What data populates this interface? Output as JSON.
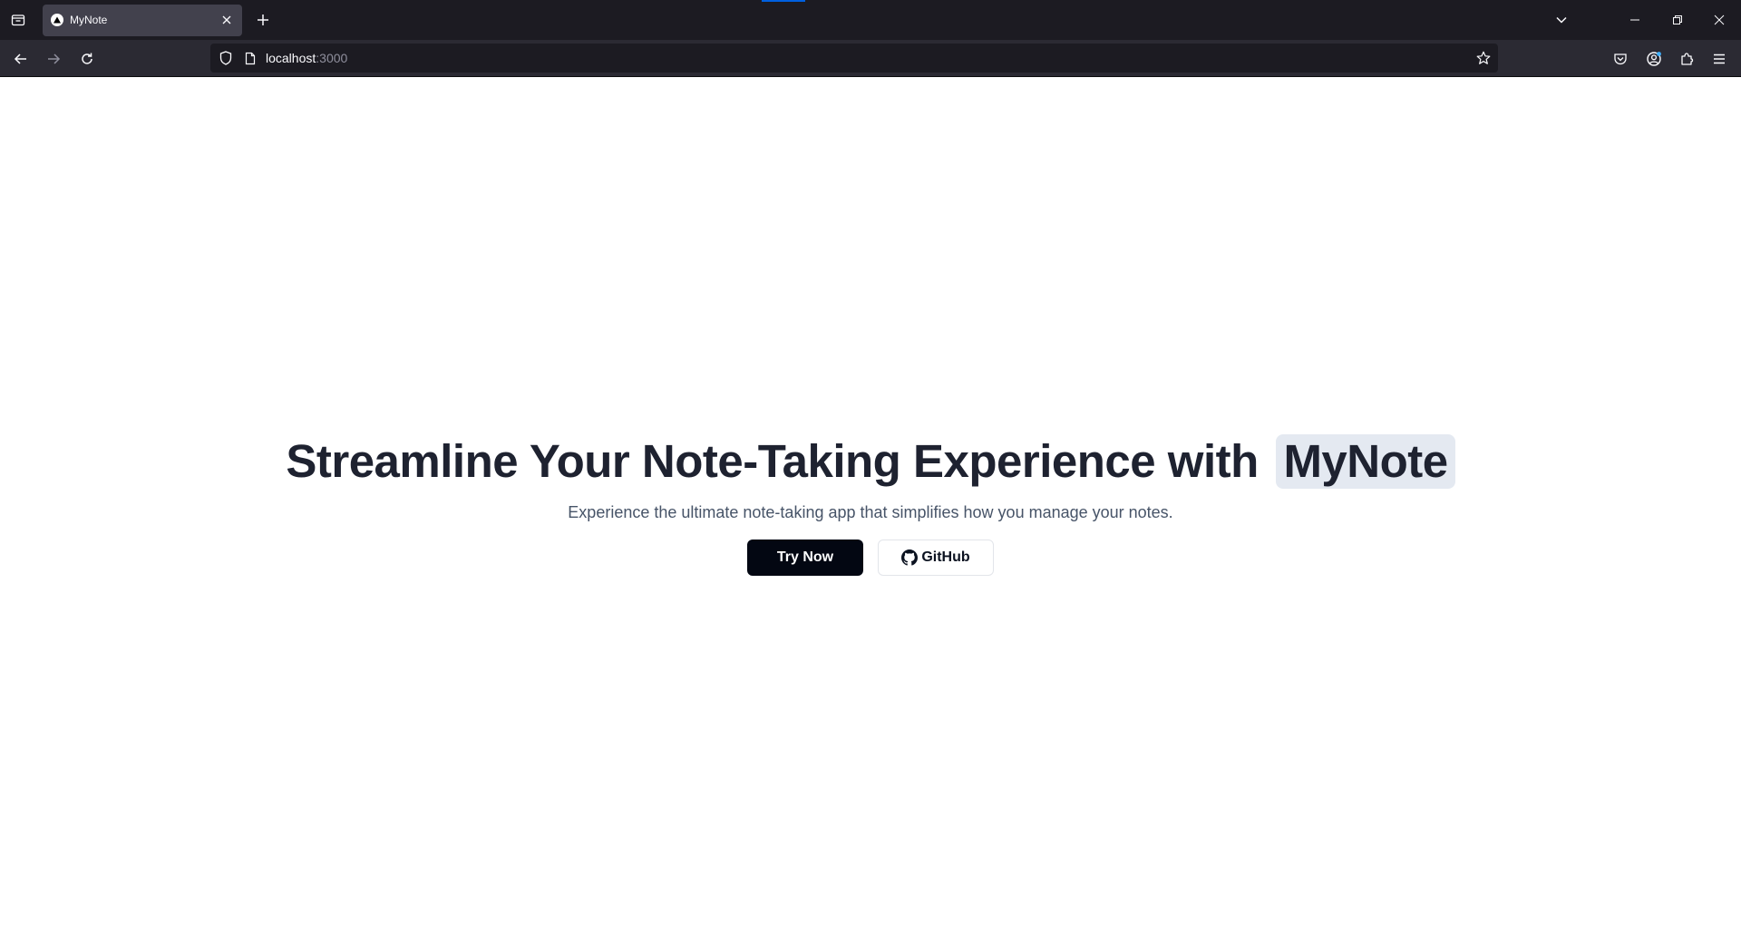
{
  "browser": {
    "tab": {
      "title": "MyNote",
      "favicon": "triangle-logo-icon"
    },
    "url": {
      "host": "localhost",
      "port": ":3000"
    },
    "icons": {
      "tab_list": "tab-list-icon",
      "close_tab": "close-icon",
      "new_tab": "plus-icon",
      "list_all_tabs": "chevron-down-icon",
      "minimize": "minimize-icon",
      "restore": "restore-icon",
      "close_window": "close-icon",
      "back": "back-arrow-icon",
      "forward": "forward-arrow-icon",
      "reload": "reload-icon",
      "tracking_protection": "shield-icon",
      "page_info": "page-icon",
      "bookmark": "star-icon",
      "pocket": "pocket-icon",
      "account": "account-icon",
      "extensions": "puzzle-icon",
      "menu": "hamburger-menu-icon"
    },
    "colors": {
      "tabstrip": "#1c1b22",
      "navbar": "#2b2a33",
      "active_tab": "#42414d",
      "loading": "#0060df"
    }
  },
  "hero": {
    "title_prefix": "Streamline Your Note-Taking Experience with",
    "title_brand": "MyNote",
    "subtitle": "Experience the ultimate note-taking app that simplifies how you manage your notes.",
    "primary_button": "Try Now",
    "secondary_button": "GitHub",
    "secondary_icon": "github-icon",
    "colors": {
      "title": "#1e2230",
      "brand_highlight": "#e4e9f1",
      "subtitle": "#475468",
      "primary_bg": "#030712"
    }
  }
}
